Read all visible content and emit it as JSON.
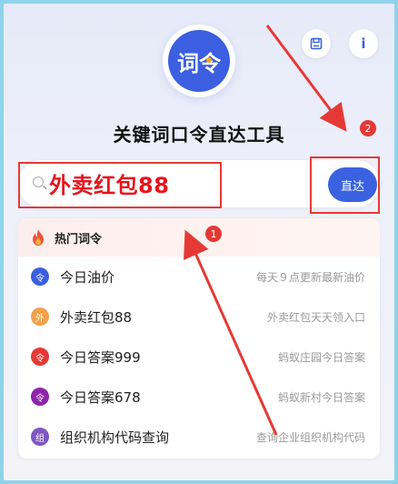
{
  "toolbar": {
    "save_icon": "save-icon",
    "info_label": "i"
  },
  "logo": {
    "text": "词令"
  },
  "app_title": "关键词口令直达工具",
  "search": {
    "value": "外卖红包88",
    "button_label": "直达"
  },
  "hot": {
    "title": "热门词令",
    "items": [
      {
        "badge": "令",
        "color": "#3a5fe0",
        "title": "今日油价",
        "desc": "每天９点更新最新油价"
      },
      {
        "badge": "外",
        "color": "#f5a04a",
        "title": "外卖红包88",
        "desc": "外卖红包天天领入口"
      },
      {
        "badge": "令",
        "color": "#e53935",
        "title": "今日答案999",
        "desc": "蚂蚁庄园今日答案"
      },
      {
        "badge": "令",
        "color": "#8e24aa",
        "title": "今日答案678",
        "desc": "蚂蚁新村今日答案"
      },
      {
        "badge": "组",
        "color": "#7e57c2",
        "title": "组织机构代码查询",
        "desc": "查询企业组织机构代码"
      }
    ]
  },
  "annotations": {
    "marker_1": "1",
    "marker_2": "2"
  }
}
